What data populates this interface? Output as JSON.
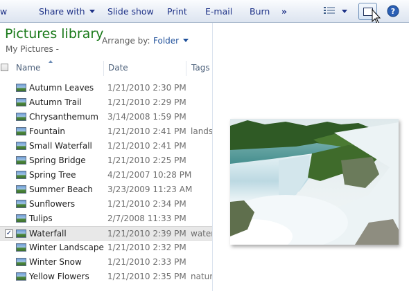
{
  "toolbar": {
    "partial_left": "w",
    "share_with": "Share with",
    "slide_show": "Slide show",
    "print": "Print",
    "email": "E-mail",
    "burn": "Burn",
    "more": "»",
    "views_icon": "details-view-icon",
    "preview_pane_icon": "preview-pane-icon",
    "help_icon": "help-icon"
  },
  "library": {
    "title": "Pictures library",
    "subtitle": "My Pictures -",
    "arrange_label": "Arrange by:",
    "arrange_value": "Folder"
  },
  "columns": {
    "name": "Name",
    "date": "Date",
    "tags": "Tags"
  },
  "files": [
    {
      "name": "Autumn Leaves",
      "date": "1/21/2010 2:30 PM",
      "tag": "",
      "checked": false
    },
    {
      "name": "Autumn Trail",
      "date": "1/21/2010 2:29 PM",
      "tag": "",
      "checked": false
    },
    {
      "name": "Chrysanthemum",
      "date": "3/14/2008 1:59 PM",
      "tag": "",
      "checked": false
    },
    {
      "name": "Fountain",
      "date": "1/21/2010 2:41 PM",
      "tag": "landsc",
      "checked": false
    },
    {
      "name": "Small Waterfall",
      "date": "1/21/2010 2:41 PM",
      "tag": "",
      "checked": false
    },
    {
      "name": "Spring Bridge",
      "date": "1/21/2010 2:25 PM",
      "tag": "",
      "checked": false
    },
    {
      "name": "Spring Tree",
      "date": "4/21/2007 10:28 PM",
      "tag": "",
      "checked": false
    },
    {
      "name": "Summer Beach",
      "date": "3/23/2009 11:23 AM",
      "tag": "",
      "checked": false
    },
    {
      "name": "Sunflowers",
      "date": "1/21/2010 2:34 PM",
      "tag": "",
      "checked": false
    },
    {
      "name": "Tulips",
      "date": "2/7/2008 11:33 PM",
      "tag": "",
      "checked": false
    },
    {
      "name": "Waterfall",
      "date": "1/21/2010 2:39 PM",
      "tag": "water",
      "checked": true
    },
    {
      "name": "Winter Landscape",
      "date": "1/21/2010 2:32 PM",
      "tag": "",
      "checked": false
    },
    {
      "name": "Winter Snow",
      "date": "1/21/2010 2:33 PM",
      "tag": "",
      "checked": false
    },
    {
      "name": "Yellow Flowers",
      "date": "1/21/2010 2:35 PM",
      "tag": "natur",
      "checked": false
    }
  ],
  "colors": {
    "library_title": "#1a7a1a",
    "toolbar_text": "#1e3287",
    "selected_row": "#e8e8e8"
  }
}
